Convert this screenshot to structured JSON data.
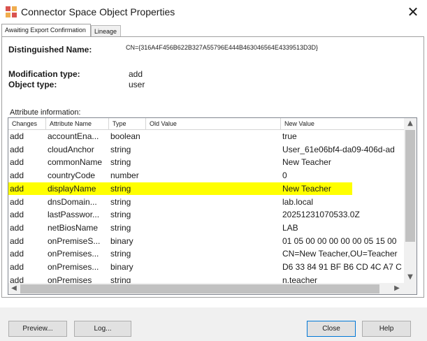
{
  "window": {
    "title": "Connector Space Object Properties"
  },
  "tabs": [
    {
      "label": "Awaiting Export Confirmation"
    },
    {
      "label": "Lineage"
    }
  ],
  "object": {
    "dn_label": "Distinguished Name:",
    "dn_value": "CN={316A4F456B622B327A55796E444B463046564E4339513D3D}",
    "mod_type_label": "Modification type:",
    "mod_type_value": "add",
    "obj_type_label": "Object type:",
    "obj_type_value": "user"
  },
  "attributes": {
    "section_label": "Attribute information:",
    "columns": [
      "Changes",
      "Attribute Name",
      "Type",
      "Old Value",
      "New Value"
    ],
    "rows": [
      {
        "change": "add",
        "name": "accountEna...",
        "type": "boolean",
        "old": "",
        "new": "true"
      },
      {
        "change": "add",
        "name": "cloudAnchor",
        "type": "string",
        "old": "",
        "new": "User_61e06bf4-da09-406d-ad"
      },
      {
        "change": "add",
        "name": "commonName",
        "type": "string",
        "old": "",
        "new": "New Teacher"
      },
      {
        "change": "add",
        "name": "countryCode",
        "type": "number",
        "old": "",
        "new": "0"
      },
      {
        "change": "add",
        "name": "displayName",
        "type": "string",
        "old": "",
        "new": "New Teacher",
        "highlighted": true
      },
      {
        "change": "add",
        "name": "dnsDomain...",
        "type": "string",
        "old": "",
        "new": "lab.local"
      },
      {
        "change": "add",
        "name": "lastPasswor...",
        "type": "string",
        "old": "",
        "new": "20251231070533.0Z"
      },
      {
        "change": "add",
        "name": "netBiosName",
        "type": "string",
        "old": "",
        "new": "LAB"
      },
      {
        "change": "add",
        "name": "onPremiseS...",
        "type": "binary",
        "old": "",
        "new": "01 05 00 00 00 00 00 05 15 00"
      },
      {
        "change": "add",
        "name": "onPremises...",
        "type": "string",
        "old": "",
        "new": "CN=New Teacher,OU=Teacher"
      },
      {
        "change": "add",
        "name": "onPremises...",
        "type": "binary",
        "old": "",
        "new": "D6 33 84 91 BF B6 CD 4C A7 C"
      },
      {
        "change": "add",
        "name": "onPremises",
        "type": "string",
        "old": "",
        "new": "n.teacher"
      }
    ]
  },
  "buttons": {
    "preview": "Preview...",
    "log": "Log...",
    "close": "Close",
    "help": "Help"
  },
  "colors": {
    "highlight": "#ffff00"
  }
}
